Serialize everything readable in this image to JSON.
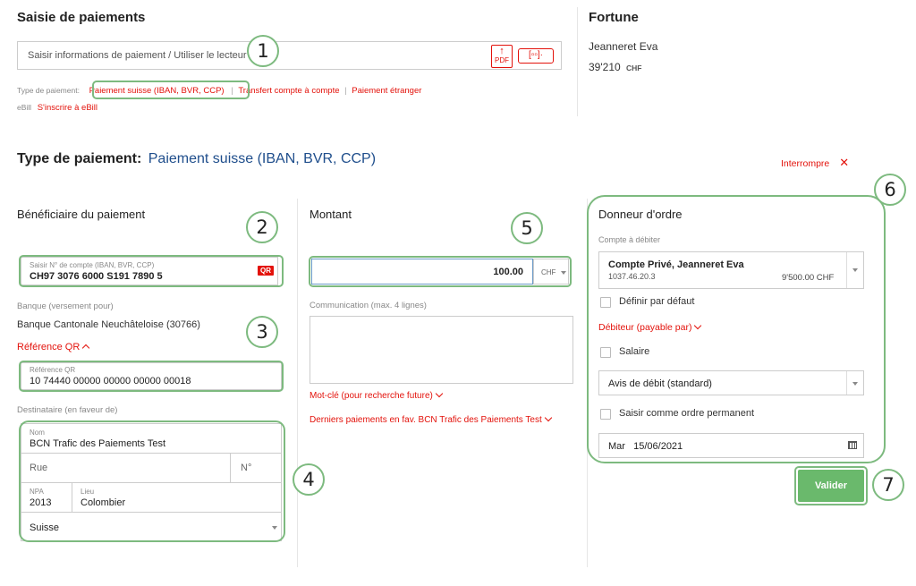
{
  "payment_entry": {
    "title": "Saisie de paiements",
    "input_placeholder": "Saisir informations de paiement / Utiliser le lecteur op",
    "pdf_label": "PDF",
    "type_label": "Type de paiement:",
    "type_options": [
      "Paiement suisse (IBAN, BVR, CCP)",
      "Transfert compte à compte",
      "Paiement étranger"
    ],
    "separator": "|",
    "ebill_label": "eBill",
    "ebill_link": "S'inscrire à eBill"
  },
  "fortune": {
    "title": "Fortune",
    "owner": "Jeanneret Eva",
    "amount": "39'210",
    "currency": "CHF"
  },
  "payment_type": {
    "label": "Type de paiement:",
    "value": "Paiement suisse (IBAN, BVR, CCP)",
    "abort": "Interrompre"
  },
  "beneficiary": {
    "heading": "Bénéficiaire du paiement",
    "account_label": "Saisir N° de compte (IBAN, BVR, CCP)",
    "account_value": "CH97 3076 6000 S191 7890 5",
    "qr_badge": "QR",
    "bank_label": "Banque (versement pour)",
    "bank_value": "Banque Cantonale Neuchâteloise (30766)",
    "qr_ref_toggle": "Référence QR",
    "qr_ref_label": "Référence QR",
    "qr_ref_value": "10 74440 00000 00000 00000 00018",
    "recipient_label": "Destinataire (en faveur de)",
    "name_label": "Nom",
    "name_value": "BCN Trafic des Paiements Test",
    "street_placeholder": "Rue",
    "number_placeholder": "N°",
    "zip_label": "NPA",
    "zip_value": "2013",
    "city_label": "Lieu",
    "city_value": "Colombier",
    "country": "Suisse"
  },
  "amount": {
    "heading": "Montant",
    "value": "100.00",
    "currency": "CHF",
    "communication_label": "Communication (max. 4 lignes)",
    "keyword_link": "Mot-clé (pour recherche future)",
    "last_payments_link": "Derniers paiements en fav. BCN Trafic des Paiements Test"
  },
  "orderer": {
    "heading": "Donneur d'ordre",
    "debit_label": "Compte à débiter",
    "account_name": "Compte Privé, Jeanneret Eva",
    "account_number": "1037.46.20.3",
    "account_balance": "9'500.00 CHF",
    "default_checkbox": "Définir par défaut",
    "debtor_link": "Débiteur (payable par)",
    "salary_checkbox": "Salaire",
    "advice_select": "Avis de débit (standard)",
    "standing_order_checkbox": "Saisir comme ordre permanent",
    "date_value": "Mar   15/06/2021",
    "submit": "Valider"
  },
  "callouts": [
    "1",
    "2",
    "3",
    "4",
    "5",
    "6",
    "7"
  ],
  "colors": {
    "accent_red": "#e3120b",
    "highlight_green": "#7dba7f",
    "button_green": "#6ab96c",
    "title_blue": "#1f4e8c"
  }
}
